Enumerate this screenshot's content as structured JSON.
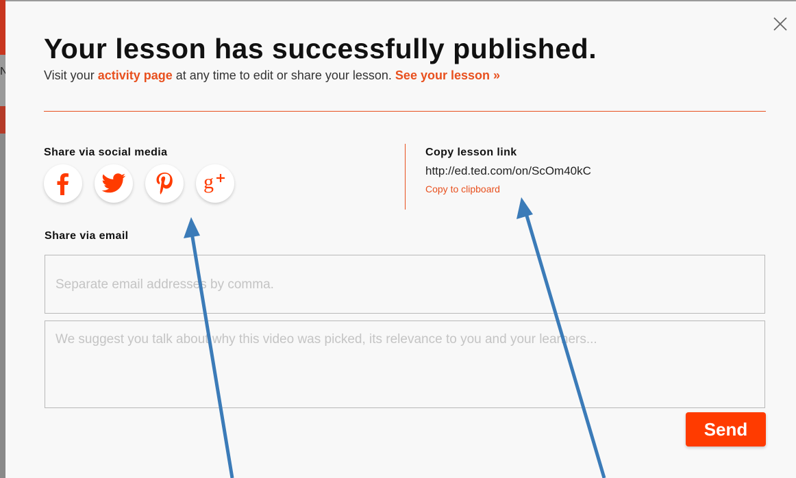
{
  "backdrop": {
    "letter": "N"
  },
  "dialog": {
    "title": "Your lesson has successfully published.",
    "subtitle": {
      "prefix": "Visit your ",
      "activity_link": "activity page",
      "middle": " at any time to edit or share your lesson. ",
      "see_lesson_link": "See your lesson »"
    },
    "social": {
      "label": "Share via social media",
      "buttons": [
        {
          "icon": "facebook-icon"
        },
        {
          "icon": "twitter-icon"
        },
        {
          "icon": "pinterest-icon"
        },
        {
          "icon": "google-plus-icon"
        }
      ]
    },
    "copy_link": {
      "label": "Copy lesson link",
      "url": "http://ed.ted.com/on/ScOm40kC",
      "copy_button": "Copy to clipboard"
    },
    "email": {
      "label": "Share via email",
      "address_placeholder": "Separate email addresses by comma.",
      "message_placeholder": "We suggest you talk about why this video was picked, its relevance to you and your learners...",
      "send_button": "Send"
    }
  },
  "colors": {
    "accent": "#e8501e",
    "send_button": "#ff3b00",
    "arrow": "#3b7bb8"
  }
}
